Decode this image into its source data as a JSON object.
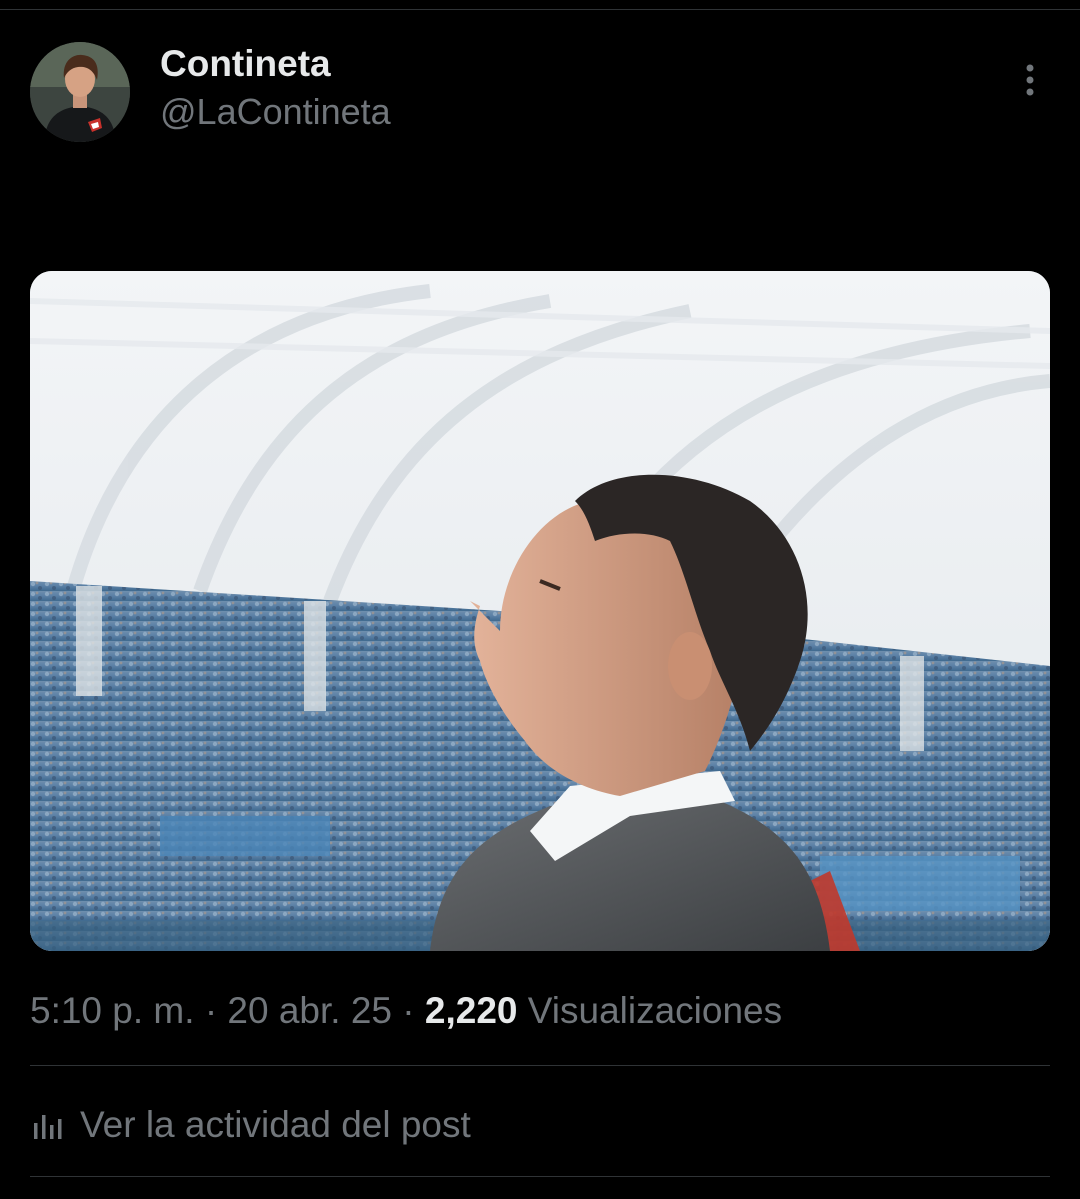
{
  "post": {
    "author": {
      "display_name": "Contineta",
      "handle": "@LaContineta",
      "avatar_icon": "avatar-photo"
    },
    "more_icon": "more-vertical-icon",
    "media": {
      "type": "photo"
    },
    "meta": {
      "time": "5:10 p. m.",
      "separator": "·",
      "date": "20 abr. 25",
      "views_count": "2,220",
      "views_label": "Visualizaciones"
    },
    "activity": {
      "icon": "analytics-icon",
      "label": "Ver la actividad del post"
    }
  },
  "colors": {
    "background": "#000000",
    "primary_text": "#e7e9ea",
    "secondary_text": "#71767b",
    "divider": "#2f3336"
  }
}
